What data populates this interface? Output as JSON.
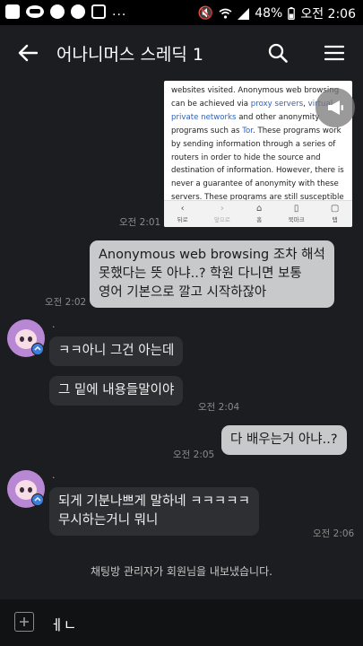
{
  "status_bar": {
    "battery": "48%",
    "time": "오전 2:06",
    "dots": "...",
    "icons": [
      "talk-icon",
      "clock-icon",
      "compass-icon",
      "check-icon",
      "mute-icon",
      "wifi-icon",
      "signal-icon",
      "battery-icon"
    ]
  },
  "header": {
    "title": "어나니머스 스레딕 1",
    "icons": [
      "back-arrow-icon",
      "search-icon",
      "menu-icon"
    ]
  },
  "image_message": {
    "lines": [
      [
        "websites visited. Anonymous web browsing"
      ],
      [
        "can be achieved via ",
        "proxy servers",
        ", ",
        "virtual"
      ],
      [
        "private networks",
        " and other anonymity"
      ],
      [
        "programs such as ",
        "Tor",
        ". These programs work"
      ],
      [
        "by sending information through a series of"
      ],
      [
        "routers in order to hide the source and"
      ],
      [
        "destination of information. However, there is"
      ],
      [
        "never a guarantee of anonymity with these"
      ],
      [
        "servers. These programs are still susceptible"
      ]
    ],
    "nav": [
      {
        "glyph": "‹",
        "label": "뒤로"
      },
      {
        "glyph": "›",
        "label": "앞으로"
      },
      {
        "glyph": "⌂",
        "label": "홈"
      },
      {
        "glyph": "▯",
        "label": "북마크"
      },
      {
        "glyph": "▢",
        "label": "탭"
      }
    ],
    "time": "오전 2:01"
  },
  "messages": [
    {
      "side": "me",
      "lines": [
        "Anonymous web browsing 조차 해석",
        "못했다는 뜻 아냐..? 학원 다니면 보통",
        "영어 기본으로 깔고 시작하잖아"
      ],
      "time": "오전 2:02"
    },
    {
      "side": "other",
      "sender": ".",
      "lines": [
        "ㅋㅋ아니 그건 아는데"
      ]
    },
    {
      "side": "other",
      "lines": [
        "그 밑에 내용들말이야"
      ],
      "time": "오전 2:04"
    },
    {
      "side": "me",
      "lines": [
        "다 배우는거 아냐..?"
      ],
      "time": "오전 2:05"
    },
    {
      "side": "other",
      "sender": ".",
      "lines": [
        "되게 기분나쁘게 말하네 ㅋㅋㅋㅋㅋ",
        "무시하는거니 뭐니"
      ],
      "time": "오전 2:06"
    }
  ],
  "notice": "채팅방 관리자가 회원님을 내보냈습니다.",
  "input": {
    "value": "ㅔㄴ"
  }
}
